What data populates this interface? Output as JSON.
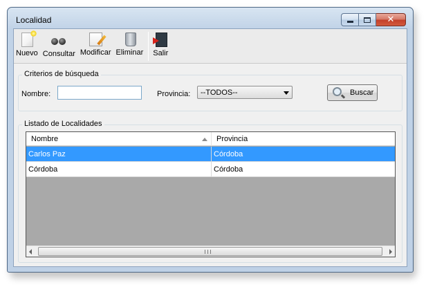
{
  "window": {
    "title": "Localidad",
    "minimize_icon": "minimize-icon",
    "maximize_icon": "maximize-icon",
    "close_icon": "close-icon",
    "close_glyph": "✕"
  },
  "toolbar": {
    "items": [
      {
        "label": "Nuevo",
        "icon": "new-document-icon"
      },
      {
        "label": "Consultar",
        "icon": "binoculars-icon"
      },
      {
        "label": "Modificar",
        "icon": "edit-document-icon"
      },
      {
        "label": "Eliminar",
        "icon": "trash-can-icon"
      },
      {
        "label": "Salir",
        "icon": "exit-door-icon"
      }
    ]
  },
  "search": {
    "group_title": "Criterios de búsqueda",
    "nombre_label": "Nombre:",
    "nombre_value": "",
    "provincia_label": "Provincia:",
    "provincia_selected": "--TODOS--",
    "buscar_label": "Buscar",
    "buscar_icon": "magnifier-icon"
  },
  "listing": {
    "group_title": "Listado de Localidades",
    "columns": [
      "Nombre",
      "Provincia"
    ],
    "sort_column": "Nombre",
    "sort_direction": "ascending",
    "rows": [
      {
        "nombre": "Carlos Paz",
        "provincia": "Córdoba",
        "selected": true
      },
      {
        "nombre": "Córdoba",
        "provincia": "Córdoba",
        "selected": false
      }
    ],
    "scroll_grip": "⁞"
  },
  "colors": {
    "selection": "#3399ff",
    "title_bar": "#c1d3e7",
    "close_button": "#c3402a"
  }
}
